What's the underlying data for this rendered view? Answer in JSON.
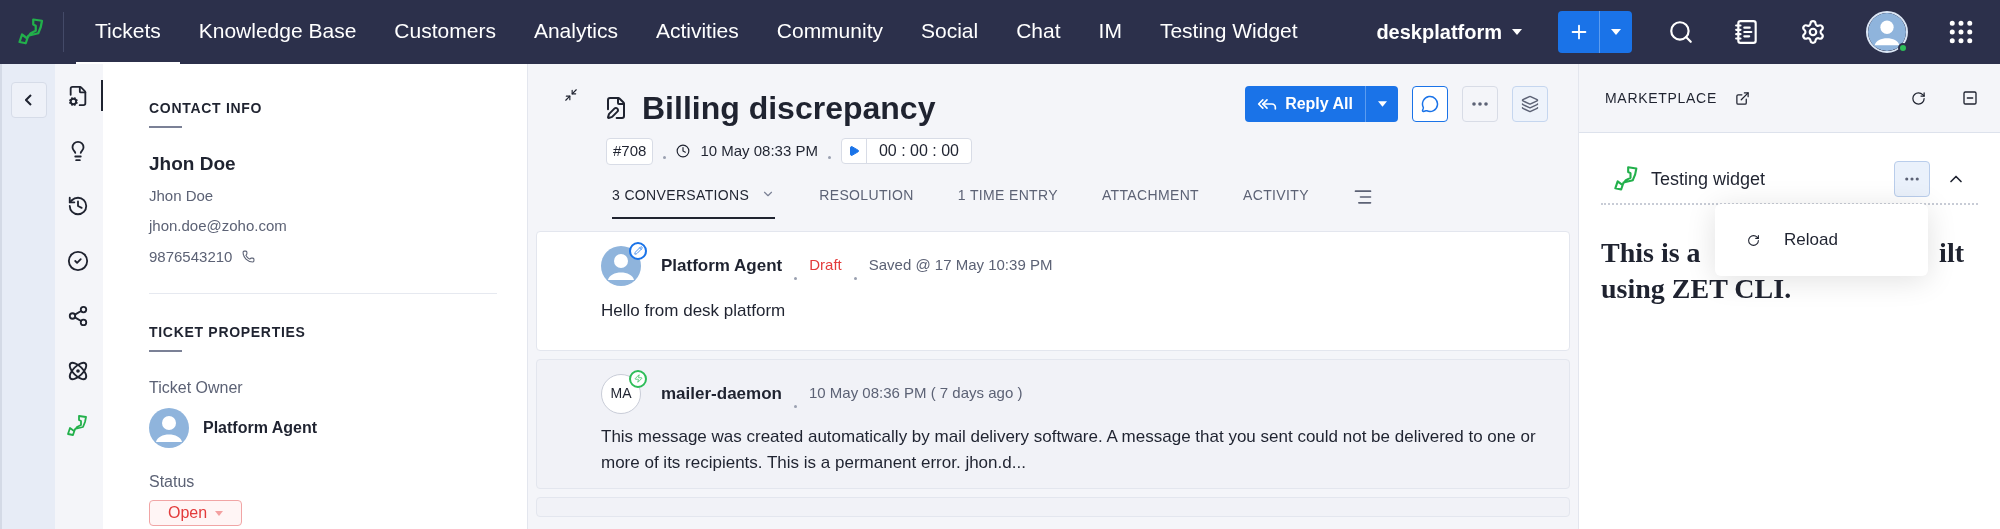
{
  "top_nav": {
    "items": [
      {
        "label": "Tickets",
        "selected": true
      },
      {
        "label": "Knowledge Base",
        "selected": false
      },
      {
        "label": "Customers",
        "selected": false
      },
      {
        "label": "Analytics",
        "selected": false
      },
      {
        "label": "Activities",
        "selected": false
      },
      {
        "label": "Community",
        "selected": false
      },
      {
        "label": "Social",
        "selected": false
      },
      {
        "label": "Chat",
        "selected": false
      },
      {
        "label": "IM",
        "selected": false
      },
      {
        "label": "Testing Widget",
        "selected": false
      }
    ],
    "portal": "deskplatform",
    "user_online": true
  },
  "side_rail": [
    {
      "selected": true
    },
    {
      "selected": false
    },
    {
      "selected": false
    },
    {
      "selected": false
    },
    {
      "selected": false
    },
    {
      "selected": false
    },
    {
      "selected": false
    }
  ],
  "contact_info": {
    "heading": "CONTACT INFO",
    "name": "Jhon Doe",
    "contact_name": "Jhon Doe",
    "email": "jhon.doe@zoho.com",
    "phone": "9876543210"
  },
  "ticket_properties": {
    "heading": "TICKET PROPERTIES",
    "owner_label": "Ticket Owner",
    "owner": "Platform Agent",
    "status_label": "Status",
    "status": "Open"
  },
  "ticket": {
    "title": "Billing discrepancy",
    "number": "#708",
    "created": "10 May 08:33 PM",
    "timer": "00 : 00 : 00",
    "reply_button": "Reply All"
  },
  "tabs": [
    {
      "label": "3 CONVERSATIONS",
      "selected": true,
      "has_menu": true
    },
    {
      "label": "RESOLUTION",
      "selected": false,
      "has_menu": false
    },
    {
      "label": "1 TIME ENTRY",
      "selected": false,
      "has_menu": false
    },
    {
      "label": "ATTACHMENT",
      "selected": false,
      "has_menu": false
    },
    {
      "label": "ACTIVITY",
      "selected": false,
      "has_menu": false
    }
  ],
  "conversations": [
    {
      "kind": "draft",
      "author": "Platform Agent",
      "tag": "Draft",
      "meta": "Saved @ 17 May 10:39 PM",
      "body": "Hello from desk platform"
    },
    {
      "kind": "incoming",
      "initials": "MA",
      "author": "mailer-daemon",
      "meta": "10 May 08:36 PM ( 7 days ago )",
      "body": "This message was created automatically by mail delivery software. A message that you sent could not be delivered to one or more of its recipients. This is a permanent error. jhon.d..."
    }
  ],
  "marketplace": {
    "heading": "MARKETPLACE",
    "widget_title": "Testing widget",
    "expanded": true,
    "widget_text_start": "This is a",
    "widget_text_end": "ilt",
    "widget_text_line2": "using ZET CLI.",
    "menu": [
      {
        "label": "Reload"
      }
    ]
  }
}
